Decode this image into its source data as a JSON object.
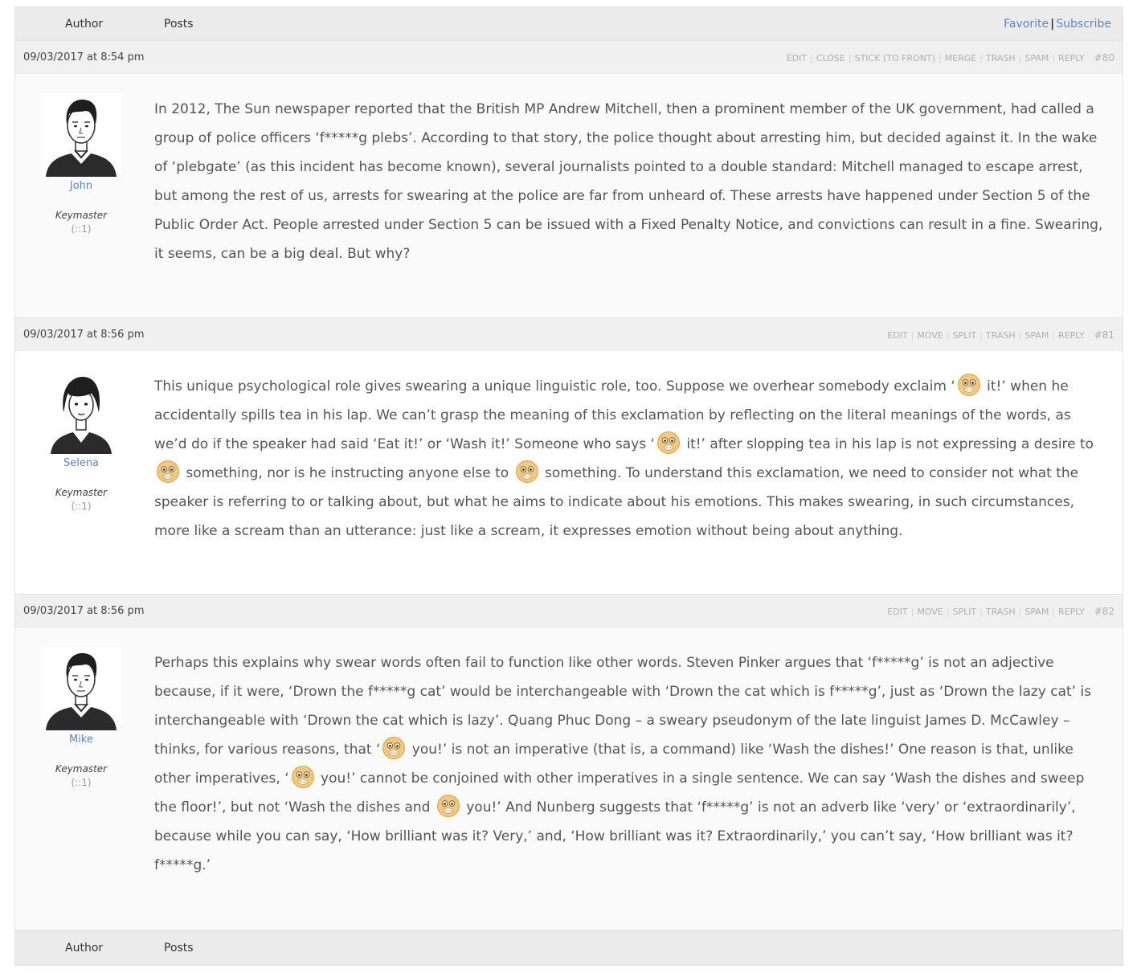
{
  "header": {
    "author_label": "Author",
    "posts_label": "Posts",
    "favorite_label": "Favorite",
    "separator": "|",
    "subscribe_label": "Subscribe"
  },
  "footer": {
    "author_label": "Author",
    "posts_label": "Posts"
  },
  "emoji_icon": "censored-swear-face-icon",
  "posts": [
    {
      "date": "09/03/2017 at 8:54 pm",
      "admin_links": [
        "EDIT",
        "CLOSE",
        "STICK (TO FRONT)",
        "MERGE",
        "TRASH",
        "SPAM",
        "REPLY"
      ],
      "number": "#80",
      "author": {
        "name": "John",
        "role": "Keymaster",
        "ip": "(::1)",
        "avatar": "man-avatar-icon"
      },
      "content": [
        {
          "t": "In 2012, The Sun newspaper reported that the British MP Andrew Mitchell, then a prominent member of the UK government, had called a group of police officers ‘f*****g plebs’. According to that story, the police thought about arresting him, but decided against it. In the wake of ‘plebgate’ (as this incident has become known), several journalists pointed to a double standard: Mitchell managed to escape arrest, but among the rest of us, arrests for swearing at the police are far from unheard of. These arrests have happened under Section 5 of the Public Order Act. People arrested under Section 5 can be issued with a Fixed Penalty Notice, and convictions can result in a fine. Swearing, it seems, can be a big deal. But why?"
        }
      ]
    },
    {
      "date": "09/03/2017 at 8:56 pm",
      "admin_links": [
        "EDIT",
        "MOVE",
        "SPLIT",
        "TRASH",
        "SPAM",
        "REPLY"
      ],
      "number": "#81",
      "author": {
        "name": "Selena",
        "role": "Keymaster",
        "ip": "(::1)",
        "avatar": "woman-avatar-icon"
      },
      "content": [
        {
          "t": "This unique psychological role gives swearing a unique linguistic role, too. Suppose we overhear somebody exclaim ‘"
        },
        {
          "e": true
        },
        {
          "t": " it!’ when he accidentally spills tea in his lap. We can’t grasp the meaning of this exclamation by reflecting on the literal meanings of the words, as we’d do if the speaker had said ‘Eat it!’ or ‘Wash it!’ Someone who says ‘"
        },
        {
          "e": true
        },
        {
          "t": " it!’ after slopping tea in his lap is not expressing a desire to "
        },
        {
          "e": true
        },
        {
          "t": " something, nor is he instructing anyone else to "
        },
        {
          "e": true
        },
        {
          "t": " something. To understand this exclamation, we need to consider not what the speaker is referring to or talking about, but what he aims to indicate about his emotions. This makes swearing, in such circumstances, more like a scream than an utterance: just like a scream, it expresses emotion without being about anything."
        }
      ]
    },
    {
      "date": "09/03/2017 at 8:56 pm",
      "admin_links": [
        "EDIT",
        "MOVE",
        "SPLIT",
        "TRASH",
        "SPAM",
        "REPLY"
      ],
      "number": "#82",
      "author": {
        "name": "Mike",
        "role": "Keymaster",
        "ip": "(::1)",
        "avatar": "man-avatar-icon"
      },
      "content": [
        {
          "t": "Perhaps this explains why swear words often fail to function like other words. Steven Pinker argues that ‘f*****g’ is not an adjective because, if it were, ‘Drown the f*****g cat’ would be interchangeable with ‘Drown the cat which is f*****g’, just as ‘Drown the lazy cat’ is interchangeable with ‘Drown the cat which is lazy’. Quang Phuc Dong – a sweary pseudonym of the late linguist James D. McCawley – thinks, for various reasons, that ‘"
        },
        {
          "e": true
        },
        {
          "t": " you!’ is not an imperative (that is, a command) like ‘Wash the dishes!’ One reason is that, unlike other imperatives, ‘"
        },
        {
          "e": true
        },
        {
          "t": " you!’ cannot be conjoined with other imperatives in a single sentence. We can say ‘Wash the dishes and sweep the floor!’, but not ‘Wash the dishes and "
        },
        {
          "e": true
        },
        {
          "t": " you!’ And Nunberg suggests that ‘f*****g’ is not an adverb like ‘very’ or ‘extraordinarily’, because while you can say, ‘How brilliant was it? Very,’ and, ‘How brilliant was it? Extraordinarily,’ you can’t say, ‘How brilliant was it? f*****g.’"
        }
      ]
    }
  ]
}
